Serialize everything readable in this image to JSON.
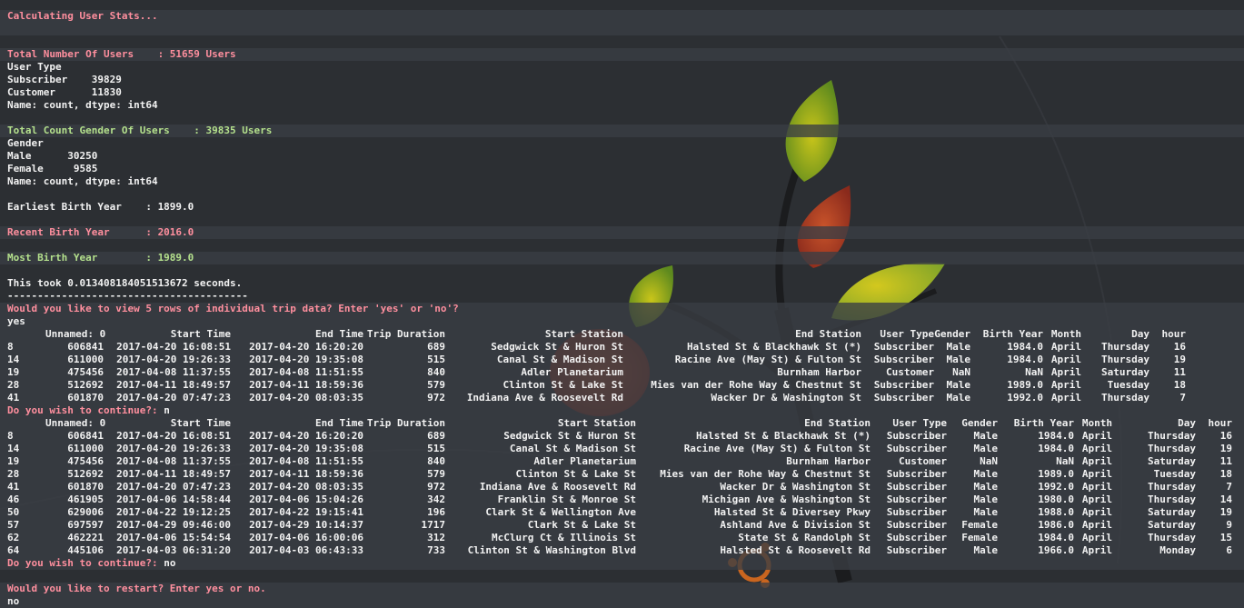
{
  "colors": {
    "background": "#2c2f33",
    "band": "#3a3e44",
    "pink": "#ff8f9e",
    "green": "#b4e08c",
    "text": "#f2f2f2"
  },
  "user_stats": {
    "calculating": "Calculating User Stats...",
    "total_users": "Total Number Of Users    : 51659 Users",
    "user_type_header": "User Type",
    "subscriber": "Subscriber    39829",
    "customer": "Customer      11830",
    "name_dtype_1": "Name: count, dtype: int64",
    "total_gender": "Total Count Gender Of Users    : 39835 Users",
    "gender_header": "Gender",
    "male": "Male      30250",
    "female": "Female     9585",
    "name_dtype_2": "Name: count, dtype: int64",
    "earliest": "Earliest Birth Year    : 1899.0",
    "recent": "Recent Birth Year      : 2016.0",
    "most": "Most Birth Year        : 1989.0",
    "took": "This took 0.013408184051513672 seconds.",
    "separator": "----------------------------------------"
  },
  "prompts": {
    "view_rows": "Would you like to view 5 rows of individual trip data? Enter 'yes' or 'no'?",
    "view_answer": "yes",
    "continue_1": "Do you wish to continue?:",
    "continue_1_answer": " n",
    "continue_2": "Do you wish to continue?:",
    "continue_2_answer": " no",
    "restart": "Would you like to restart? Enter yes or no.",
    "restart_answer": "no"
  },
  "table1": {
    "headers": [
      "",
      "Unnamed: 0",
      "Start Time",
      "End Time",
      "Trip Duration",
      "Start Station",
      "End Station",
      "User Type",
      "Gender",
      "Birth Year",
      "Month",
      "Day",
      "hour"
    ],
    "rows": [
      [
        "8",
        "606841",
        "2017-04-20 16:08:51",
        "2017-04-20 16:20:20",
        "689",
        "Sedgwick St & Huron St",
        "Halsted St & Blackhawk St (*)",
        "Subscriber",
        "Male",
        "1984.0",
        "April",
        "Thursday",
        "16"
      ],
      [
        "14",
        "611000",
        "2017-04-20 19:26:33",
        "2017-04-20 19:35:08",
        "515",
        "Canal St & Madison St",
        "Racine Ave (May St) & Fulton St",
        "Subscriber",
        "Male",
        "1984.0",
        "April",
        "Thursday",
        "19"
      ],
      [
        "19",
        "475456",
        "2017-04-08 11:37:55",
        "2017-04-08 11:51:55",
        "840",
        "Adler Planetarium",
        "Burnham Harbor",
        "Customer",
        "NaN",
        "NaN",
        "April",
        "Saturday",
        "11"
      ],
      [
        "28",
        "512692",
        "2017-04-11 18:49:57",
        "2017-04-11 18:59:36",
        "579",
        "Clinton St & Lake St",
        "Mies van der Rohe Way & Chestnut St",
        "Subscriber",
        "Male",
        "1989.0",
        "April",
        "Tuesday",
        "18"
      ],
      [
        "41",
        "601870",
        "2017-04-20 07:47:23",
        "2017-04-20 08:03:35",
        "972",
        "Indiana Ave & Roosevelt Rd",
        "Wacker Dr & Washington St",
        "Subscriber",
        "Male",
        "1992.0",
        "April",
        "Thursday",
        "7"
      ]
    ]
  },
  "table2": {
    "headers": [
      "",
      "Unnamed: 0",
      "Start Time",
      "End Time",
      "Trip Duration",
      "Start Station",
      "End Station",
      "User Type",
      "Gender",
      "Birth Year",
      "Month",
      "Day",
      "hour"
    ],
    "rows": [
      [
        "8",
        "606841",
        "2017-04-20 16:08:51",
        "2017-04-20 16:20:20",
        "689",
        "Sedgwick St & Huron St",
        "Halsted St & Blackhawk St (*)",
        "Subscriber",
        "Male",
        "1984.0",
        "April",
        "Thursday",
        "16"
      ],
      [
        "14",
        "611000",
        "2017-04-20 19:26:33",
        "2017-04-20 19:35:08",
        "515",
        "Canal St & Madison St",
        "Racine Ave (May St) & Fulton St",
        "Subscriber",
        "Male",
        "1984.0",
        "April",
        "Thursday",
        "19"
      ],
      [
        "19",
        "475456",
        "2017-04-08 11:37:55",
        "2017-04-08 11:51:55",
        "840",
        "Adler Planetarium",
        "Burnham Harbor",
        "Customer",
        "NaN",
        "NaN",
        "April",
        "Saturday",
        "11"
      ],
      [
        "28",
        "512692",
        "2017-04-11 18:49:57",
        "2017-04-11 18:59:36",
        "579",
        "Clinton St & Lake St",
        "Mies van der Rohe Way & Chestnut St",
        "Subscriber",
        "Male",
        "1989.0",
        "April",
        "Tuesday",
        "18"
      ],
      [
        "41",
        "601870",
        "2017-04-20 07:47:23",
        "2017-04-20 08:03:35",
        "972",
        "Indiana Ave & Roosevelt Rd",
        "Wacker Dr & Washington St",
        "Subscriber",
        "Male",
        "1992.0",
        "April",
        "Thursday",
        "7"
      ],
      [
        "46",
        "461905",
        "2017-04-06 14:58:44",
        "2017-04-06 15:04:26",
        "342",
        "Franklin St & Monroe St",
        "Michigan Ave & Washington St",
        "Subscriber",
        "Male",
        "1980.0",
        "April",
        "Thursday",
        "14"
      ],
      [
        "50",
        "629006",
        "2017-04-22 19:12:25",
        "2017-04-22 19:15:41",
        "196",
        "Clark St & Wellington Ave",
        "Halsted St & Diversey Pkwy",
        "Subscriber",
        "Male",
        "1988.0",
        "April",
        "Saturday",
        "19"
      ],
      [
        "57",
        "697597",
        "2017-04-29 09:46:00",
        "2017-04-29 10:14:37",
        "1717",
        "Clark St & Lake St",
        "Ashland Ave & Division St",
        "Subscriber",
        "Female",
        "1986.0",
        "April",
        "Saturday",
        "9"
      ],
      [
        "62",
        "462221",
        "2017-04-06 15:54:54",
        "2017-04-06 16:00:06",
        "312",
        "McClurg Ct & Illinois St",
        "State St & Randolph St",
        "Subscriber",
        "Female",
        "1984.0",
        "April",
        "Thursday",
        "15"
      ],
      [
        "64",
        "445106",
        "2017-04-03 06:31:20",
        "2017-04-03 06:43:33",
        "733",
        "Clinton St & Washington Blvd",
        "Halsted St & Roosevelt Rd",
        "Subscriber",
        "Male",
        "1966.0",
        "April",
        "Monday",
        "6"
      ]
    ]
  }
}
